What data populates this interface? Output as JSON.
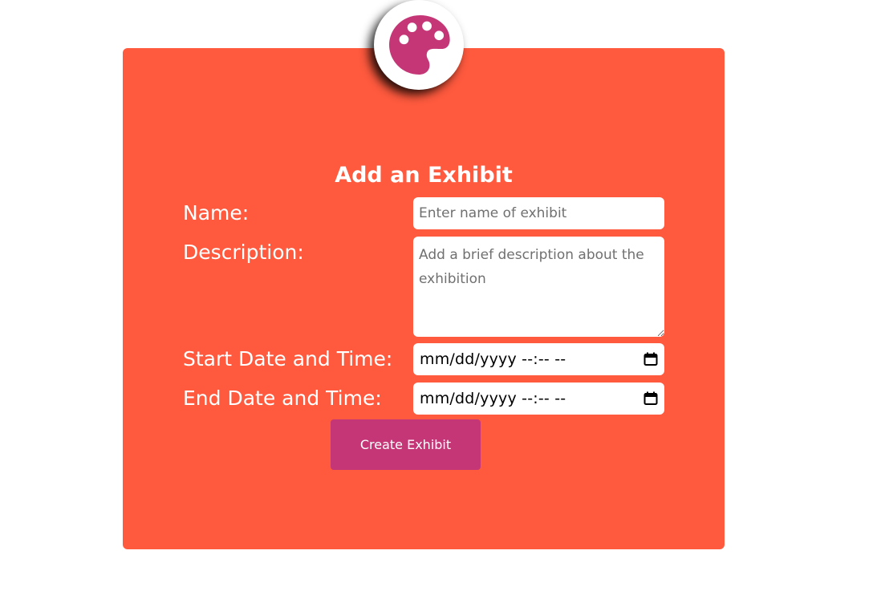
{
  "app": {
    "logo_icon": "palette-icon",
    "colors": {
      "card_background": "#ff5a3e",
      "accent": "#c53677",
      "text_on_card": "#ffffff"
    }
  },
  "form": {
    "title": "Add an Exhibit",
    "name": {
      "label": "Name:",
      "placeholder": "Enter name of exhibit",
      "value": ""
    },
    "description": {
      "label": "Description:",
      "placeholder": "Add a brief description about the exhibition",
      "value": ""
    },
    "start": {
      "label": "Start Date and Time:",
      "display": "mm/dd/yyyy --:-- --",
      "icon": "calendar-icon"
    },
    "end": {
      "label": "End Date and Time:",
      "display": "mm/dd/yyyy --:-- --",
      "icon": "calendar-icon"
    },
    "submit_label": "Create Exhibit"
  }
}
